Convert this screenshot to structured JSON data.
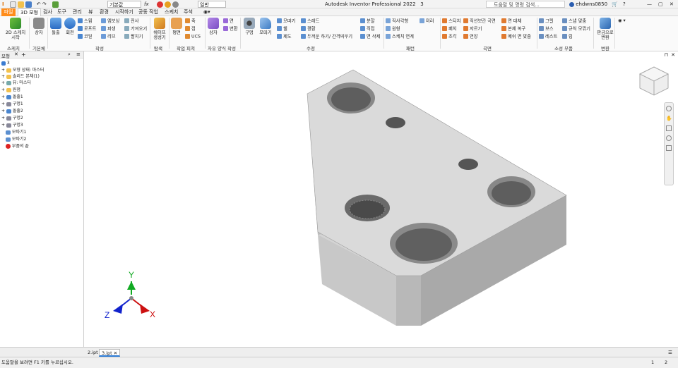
{
  "titlebar": {
    "title": "Autodesk Inventor Professional 2022",
    "doc_number": "3",
    "material": "기본값",
    "appearance": "일반",
    "search_placeholder": "도움말 및 명령 검색...",
    "user": "ehdwns0850"
  },
  "tabs": [
    "파일",
    "3D 모형",
    "검사",
    "도구",
    "관리",
    "뷰",
    "환경",
    "시작하기",
    "공동 작업",
    "스케치",
    "주석"
  ],
  "ribbon": {
    "sketch_big": "2D 스케치\n시작",
    "sketch_group": "스케치",
    "basic": {
      "extrude": "상자",
      "revolve": "돌출",
      "rev2": "회전",
      "group": "기본체"
    },
    "create_small": [
      "스윕",
      "로프트",
      "코일",
      "엠보싱",
      "파생",
      "리브",
      "전사",
      "가져오기",
      "팔치기"
    ],
    "create_group": "작성",
    "explore_big": "쉐이프\n생성기",
    "explore_group": "탐색",
    "workfeat": {
      "plane": "평면",
      "axis": "축",
      "point": "점",
      "ucs": "UCS",
      "group": "작업 피쳐"
    },
    "freeform": {
      "box": "상자",
      "face": "면",
      "convert": "변환",
      "group": "자유 양식 작성"
    },
    "modify": {
      "hole": "구멍",
      "fillet": "모따기",
      "items": [
        "모따기",
        "쉘",
        "제도",
        "스레드",
        "결합",
        "두꺼운 하기/ 간격띄우기",
        "분할",
        "직접",
        "면 삭제"
      ],
      "group": "수정"
    },
    "pattern": {
      "items": [
        "직사각형",
        "원형",
        "스케치 연계",
        "미러"
      ],
      "group": "패턴"
    },
    "surface": {
      "items": [
        "스티치",
        "패치",
        "조각",
        "직선보간 곡면",
        "자르기",
        "연장",
        "면 대체",
        "본체 복구",
        "메쉬 면 맞춤"
      ],
      "group": "곡면"
    },
    "plastic": {
      "items": [
        "그릴",
        "보스",
        "레스트",
        "스냅 맞춤",
        "규칙 모깎기",
        "립"
      ],
      "group": "소성 부품"
    },
    "convert": {
      "label": "판금으로\n변환",
      "group": "변환"
    }
  },
  "browser": {
    "tab_label": "모형",
    "root": "3",
    "items": [
      {
        "label": "모형 상태: 마스터",
        "icon": "folder"
      },
      {
        "label": "솔리드 본체(1)",
        "icon": "folder"
      },
      {
        "label": "뷰: 마스터",
        "icon": "view"
      },
      {
        "label": "원점",
        "icon": "folder"
      },
      {
        "label": "돌출1",
        "icon": "feature"
      },
      {
        "label": "구멍1",
        "icon": "hole"
      },
      {
        "label": "돌출2",
        "icon": "feature"
      },
      {
        "label": "구멍2",
        "icon": "hole"
      },
      {
        "label": "구멍3",
        "icon": "hole"
      },
      {
        "label": "모따기1",
        "icon": "chamfer"
      },
      {
        "label": "모따기2",
        "icon": "chamfer"
      },
      {
        "label": "부품의 끝",
        "icon": "end"
      }
    ]
  },
  "triad": {
    "x": "X",
    "y": "Y",
    "z": "Z"
  },
  "doctabs": [
    "2.ipt",
    "3.ipt"
  ],
  "status": {
    "hint": "도움말을 보려면 F1 키를 누르십시오.",
    "count1": "1",
    "count2": "2"
  },
  "colors": {
    "file_tab": "#ff8c1a",
    "x_axis": "#cc1111",
    "y_axis": "#11aa22",
    "z_axis": "#1122cc"
  }
}
